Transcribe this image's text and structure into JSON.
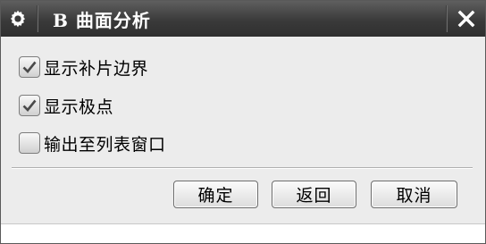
{
  "window": {
    "title": "B  曲面分析",
    "title_icon": "gear-icon",
    "close_icon": "close-icon"
  },
  "options": [
    {
      "label": "显示补片边界",
      "checked": true
    },
    {
      "label": "显示极点",
      "checked": true
    },
    {
      "label": "输出至列表窗口",
      "checked": false
    }
  ],
  "buttons": {
    "ok": "确定",
    "back": "返回",
    "cancel": "取消"
  },
  "colors": {
    "titlebar": "#3a3a3a",
    "dialog_bg": "#ececec"
  }
}
